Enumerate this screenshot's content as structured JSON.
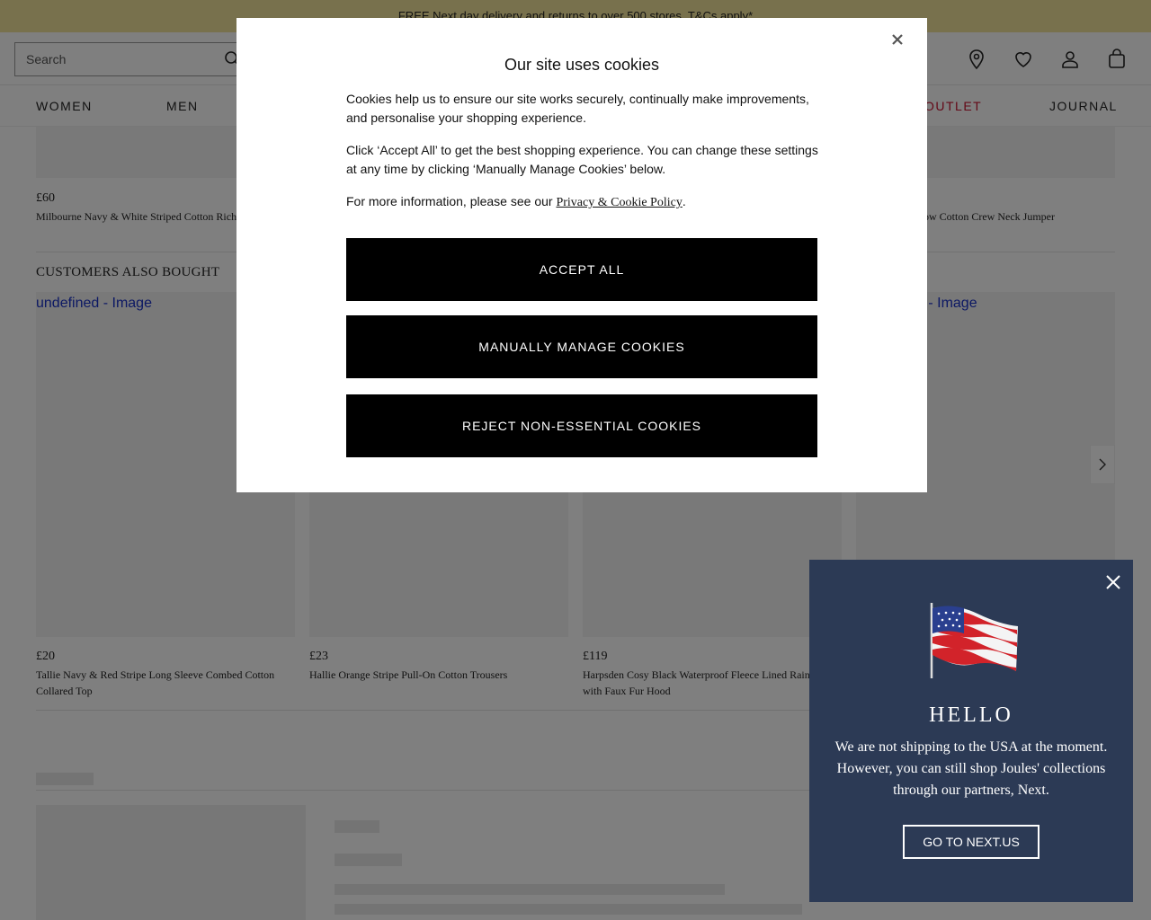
{
  "promo_text": "FREE Next day delivery and returns to over 500 stores. T&Cs apply*",
  "search": {
    "placeholder": "Search"
  },
  "header_icons": [
    "location-pin-icon",
    "heart-icon",
    "account-icon",
    "bag-icon"
  ],
  "nav": {
    "items": [
      "WOMEN",
      "MEN",
      "OUTLET",
      "JOURNAL"
    ]
  },
  "top_row": {
    "products": [
      {
        "price": "£60",
        "name": "Milbourne Navy & White Striped Cotton Rich"
      },
      {
        "price": "",
        "name": "ellow Cotton Crew Neck Jumper"
      }
    ]
  },
  "customers_also_bought": {
    "title": "CUSTOMERS ALSO BOUGHT",
    "image_alt": "undefined - Image",
    "image_alt_partial": "d - Image",
    "products": [
      {
        "price": "£20",
        "name": "Tallie Navy & Red Stripe Long Sleeve Combed Cotton Collared Top"
      },
      {
        "price": "£23",
        "name": "Hallie Orange Stripe Pull-On Cotton Trousers"
      },
      {
        "price": "£119",
        "name": "Harpsden Cosy Black Waterproof Fleece Lined Rain with Faux Fur Hood"
      }
    ]
  },
  "cookie_modal": {
    "title": "Our site uses cookies",
    "p1": "Cookies help us to ensure our site works securely, continually make improvements, and personalise your shopping experience.",
    "p2": "Click ‘Accept All’ to get the best shopping experience. You can change these settings at any time by clicking ‘Manually Manage Cookies’ below.",
    "p3_prefix": "For more information, please see our ",
    "p3_link": "Privacy & Cookie Policy",
    "p3_suffix": ".",
    "buttons": {
      "accept": "ACCEPT ALL",
      "manage": "MANUALLY MANAGE COOKIES",
      "reject": "REJECT NON-ESSENTIAL COOKIES"
    }
  },
  "geo_popup": {
    "title": "HELLO",
    "text": "We are not shipping to the USA at the moment. However, you can still shop Joules' collections through our partners, Next.",
    "button": "GO TO NEXT.US",
    "background": "#2c3a55"
  },
  "colors": {
    "promo_bg": "#f0e39a",
    "outlet": "#c8102e",
    "link_blue": "#1a32c8"
  }
}
